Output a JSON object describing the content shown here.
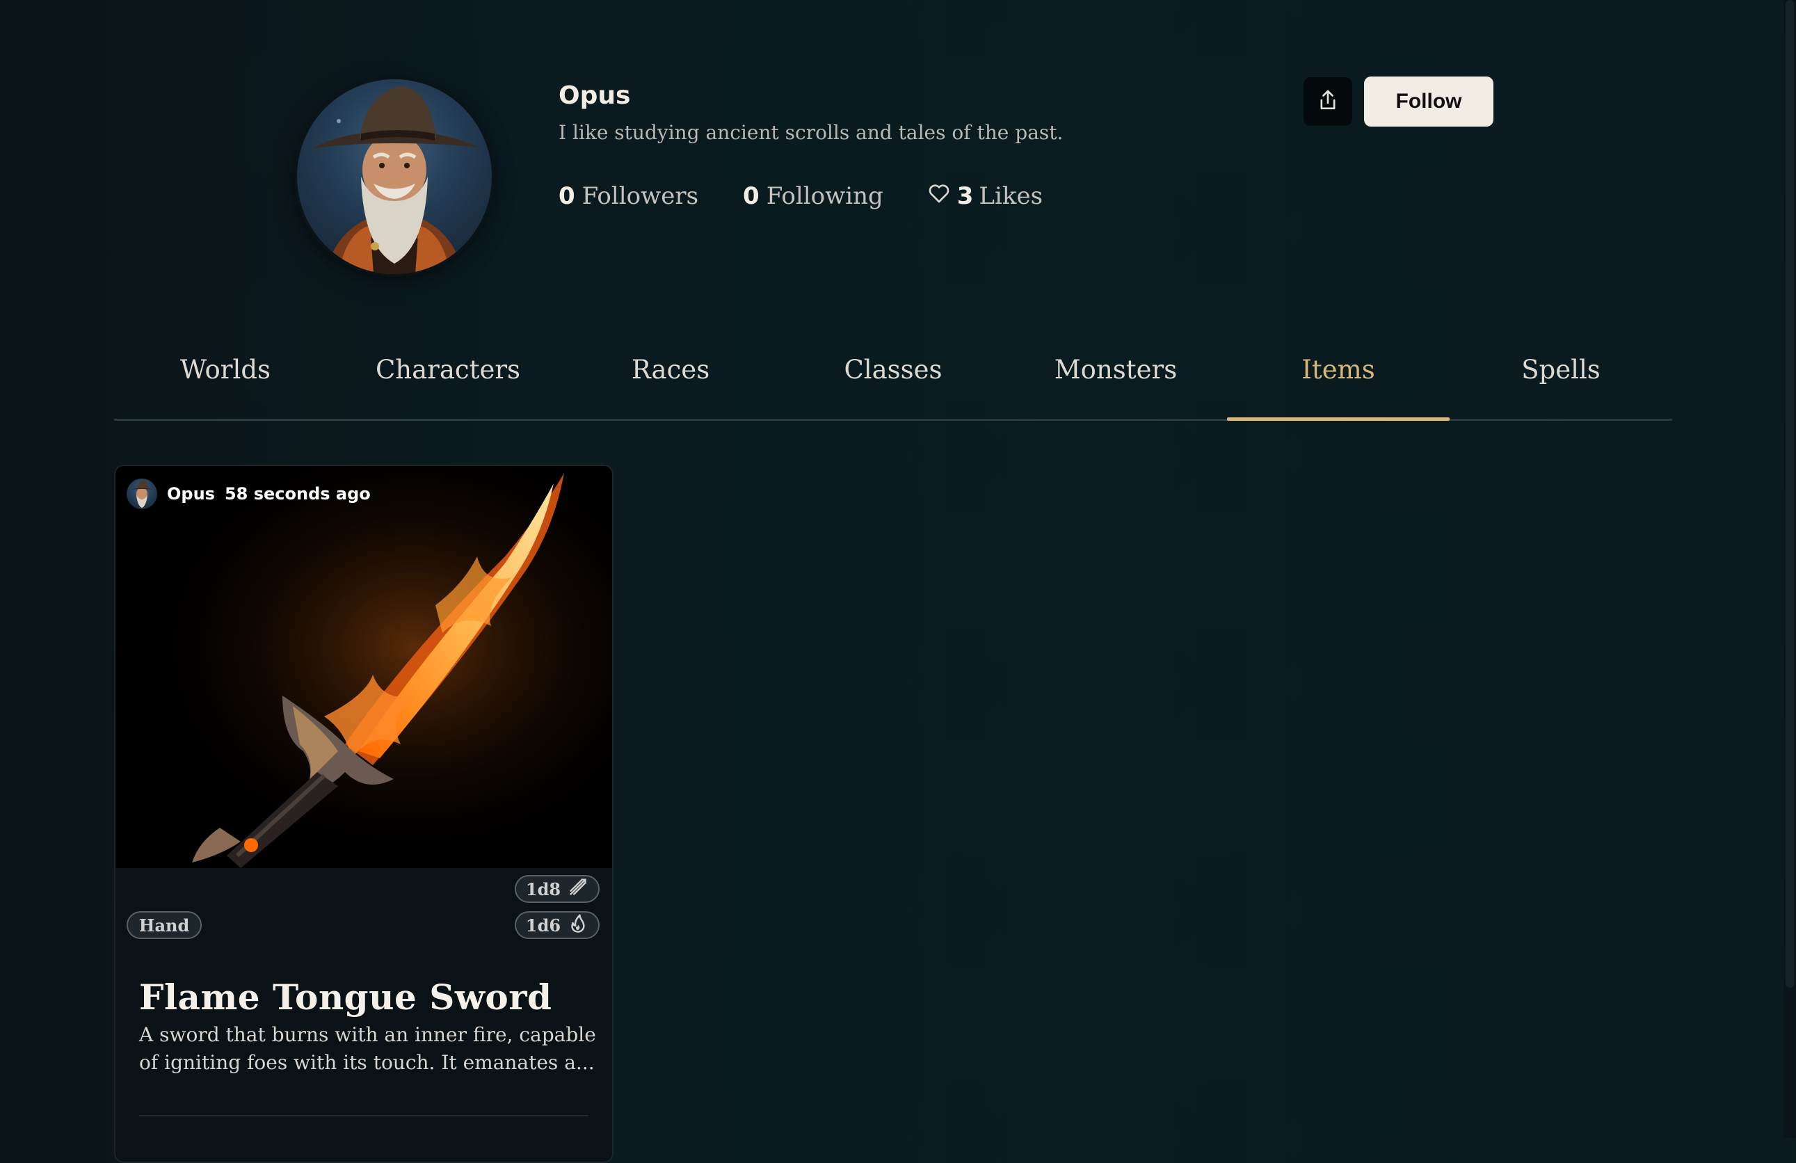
{
  "profile": {
    "name": "Opus",
    "bio": "I like studying ancient scrolls and tales of the past.",
    "followers_count": "0",
    "followers_label": "Followers",
    "following_count": "0",
    "following_label": "Following",
    "likes_count": "3",
    "likes_label": "Likes",
    "follow_label": "Follow"
  },
  "tabs": [
    {
      "label": "Worlds"
    },
    {
      "label": "Characters"
    },
    {
      "label": "Races"
    },
    {
      "label": "Classes"
    },
    {
      "label": "Monsters"
    },
    {
      "label": "Items",
      "active": true
    },
    {
      "label": "Spells"
    }
  ],
  "items": [
    {
      "author": "Opus",
      "time": "58 seconds ago",
      "damage_1": "1d8",
      "damage_1_icon": "slashing-damage-icon",
      "damage_2": "1d6",
      "damage_2_icon": "fire-damage-icon",
      "slot": "Hand",
      "title": "Flame Tongue Sword",
      "description": "A sword that burns with an inner fire, capable of igniting foes with its touch. It emanates a..."
    }
  ],
  "colors": {
    "accent": "#d9b779",
    "background": "#0a1a1f",
    "follow_button": "#f1ede4"
  }
}
